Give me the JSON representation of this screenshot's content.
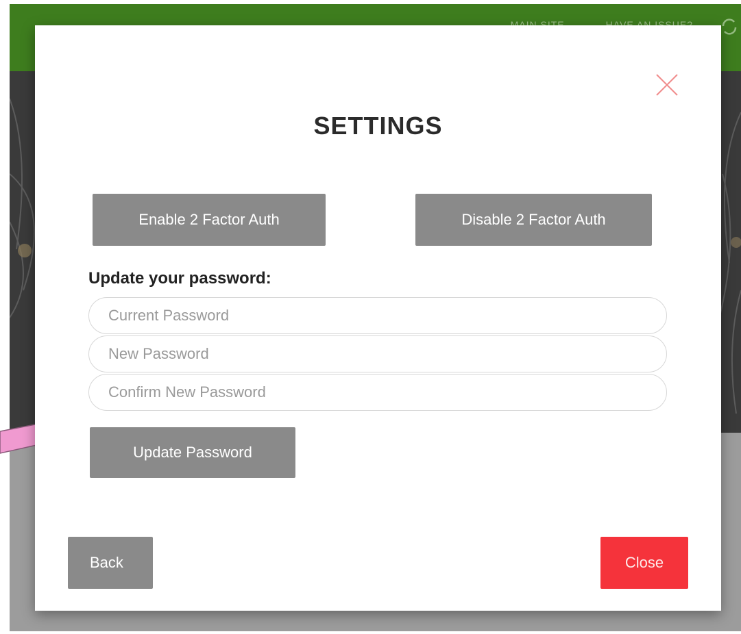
{
  "background": {
    "nav_items": [
      "MAIN SITE",
      "HAVE AN ISSUE?"
    ],
    "topbar_color": "#3e7d1e",
    "refresh_icon": "refresh-icon"
  },
  "modal": {
    "title": "SETTINGS",
    "close_icon": "close-icon",
    "enable_2fa_label": "Enable 2 Factor Auth",
    "disable_2fa_label": "Disable 2 Factor Auth",
    "password_section_label": "Update your password:",
    "current_password": {
      "value": "",
      "placeholder": "Current Password"
    },
    "new_password": {
      "value": "",
      "placeholder": "New Password"
    },
    "confirm_password": {
      "value": "",
      "placeholder": "Confirm New Password"
    },
    "update_password_label": "Update Password",
    "back_label": "Back",
    "close_label": "Close"
  },
  "colors": {
    "button_gray": "#8a8a8a",
    "close_red": "#f5333b",
    "close_x": "#f08a8a",
    "annotation_arrow": "#f09ad0"
  }
}
